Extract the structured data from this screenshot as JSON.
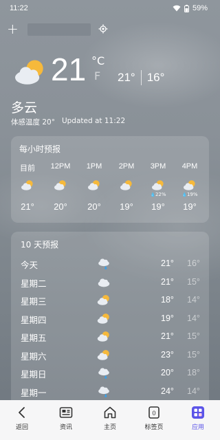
{
  "status": {
    "time": "11:22",
    "battery": "59%"
  },
  "top": {
    "add_label": "+"
  },
  "current": {
    "temp": "21",
    "unit_c": "°C",
    "unit_f": "F",
    "high": "21°",
    "low": "16°",
    "condition": "多云",
    "feels_like": "体感温度 20°",
    "updated": "Updated at 11:22"
  },
  "hourly": {
    "title": "每小时预报",
    "items": [
      {
        "label": "目前",
        "precip": "",
        "temp": "21°",
        "icon": "partly-cloudy-icon"
      },
      {
        "label": "12PM",
        "precip": "",
        "temp": "20°",
        "icon": "partly-cloudy-icon"
      },
      {
        "label": "1PM",
        "precip": "",
        "temp": "20°",
        "icon": "partly-cloudy-icon"
      },
      {
        "label": "2PM",
        "precip": "",
        "temp": "19°",
        "icon": "partly-cloudy-icon"
      },
      {
        "label": "3PM",
        "precip": "22%",
        "temp": "19°",
        "icon": "partly-cloudy-icon"
      },
      {
        "label": "4PM",
        "precip": "19%",
        "temp": "19°",
        "icon": "partly-cloudy-icon"
      }
    ]
  },
  "daily": {
    "title": "10 天预报",
    "items": [
      {
        "day": "今天",
        "high": "21°",
        "low": "16°",
        "icon": "rain-icon"
      },
      {
        "day": "星期二",
        "high": "21°",
        "low": "15°",
        "icon": "cloud-icon"
      },
      {
        "day": "星期三",
        "high": "18°",
        "low": "14°",
        "icon": "partly-cloudy-icon"
      },
      {
        "day": "星期四",
        "high": "19°",
        "low": "14°",
        "icon": "partly-cloudy-icon"
      },
      {
        "day": "星期五",
        "high": "21°",
        "low": "15°",
        "icon": "partly-cloudy-icon"
      },
      {
        "day": "星期六",
        "high": "23°",
        "low": "15°",
        "icon": "partly-cloudy-icon"
      },
      {
        "day": "星期日",
        "high": "20°",
        "low": "18°",
        "icon": "rain-icon"
      },
      {
        "day": "星期一",
        "high": "24°",
        "low": "14°",
        "icon": "rain-icon"
      }
    ]
  },
  "nav": {
    "items": [
      {
        "label": "返回",
        "icon": "back-icon"
      },
      {
        "label": "资讯",
        "icon": "news-icon"
      },
      {
        "label": "主页",
        "icon": "home-icon"
      },
      {
        "label": "标签页",
        "icon": "tabs-icon",
        "count": "0"
      },
      {
        "label": "应用",
        "icon": "apps-icon"
      }
    ]
  },
  "colors": {
    "accent": "#5b54e8",
    "sun": "#f6b93b",
    "rain": "#3aa0e8"
  }
}
